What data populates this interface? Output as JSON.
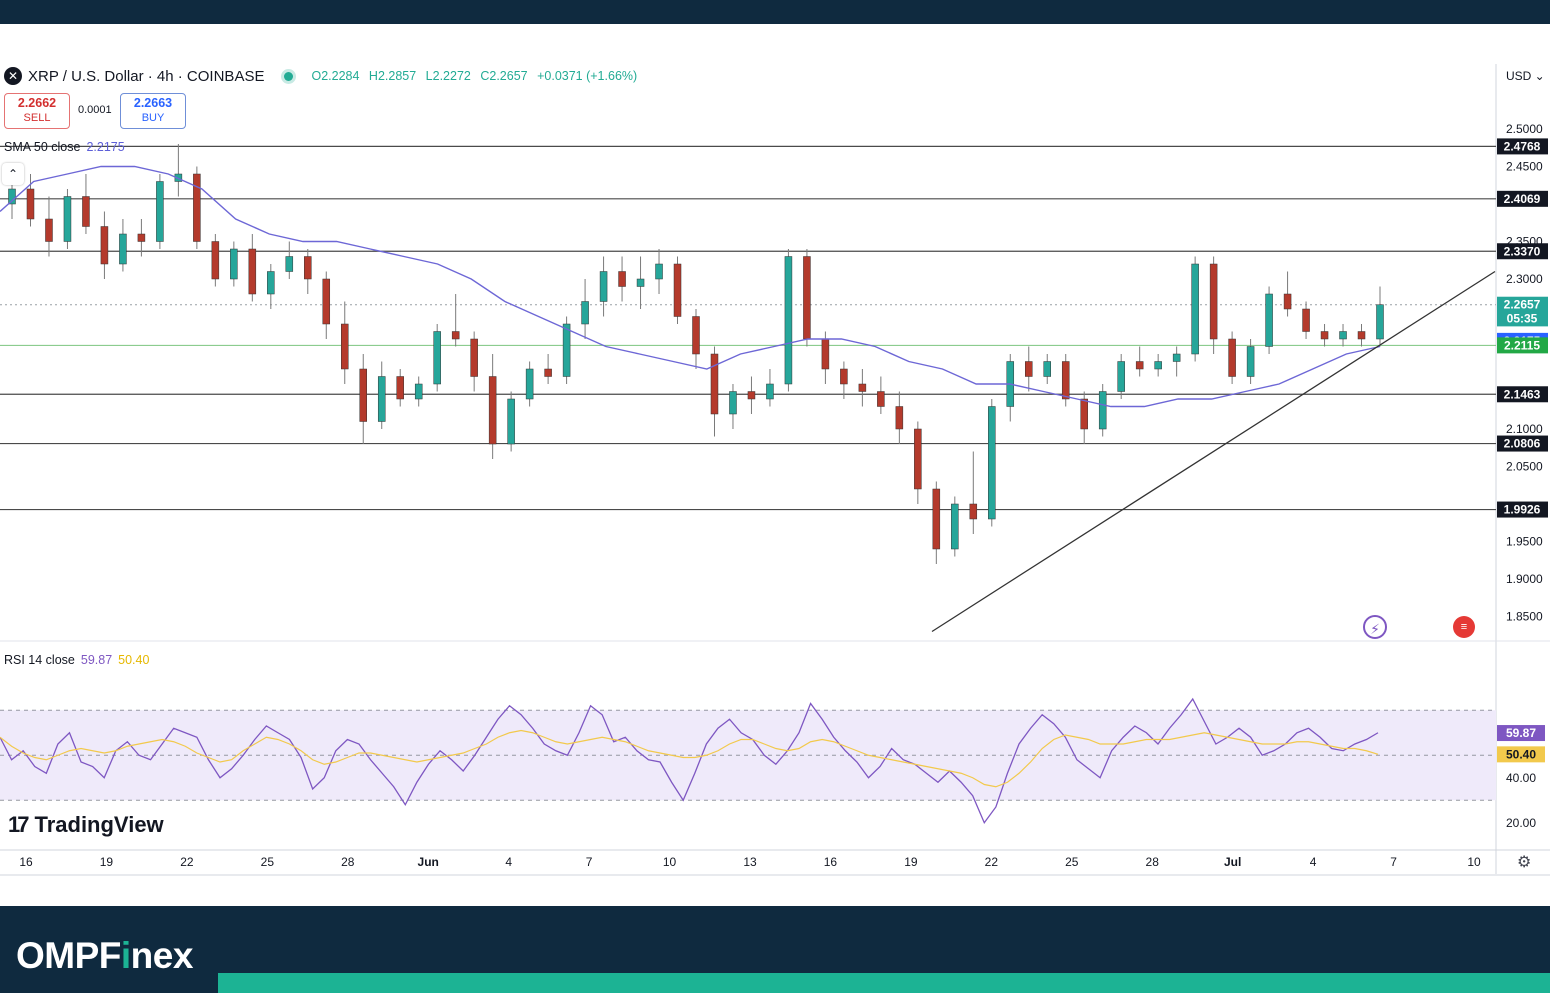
{
  "header": {
    "symbol_icon": "x-icon",
    "title": "XRP / U.S. Dollar · 4h · COINBASE",
    "open": "O2.2284",
    "high": "H2.2857",
    "low": "L2.2272",
    "close": "C2.2657",
    "change": "+0.0371 (+1.66%)",
    "status_color": "#22ab94"
  },
  "trade": {
    "sell_price": "2.2662",
    "sell_label": "SELL",
    "spread": "0.0001",
    "buy_price": "2.2663",
    "buy_label": "BUY"
  },
  "sma": {
    "label": "SMA 50 close",
    "value": "2.2175",
    "color": "#5d5fd8"
  },
  "rsi": {
    "label": "RSI 14 close",
    "value": "59.87",
    "ma_value": "50.40",
    "color": "#7e57c2",
    "ma_color": "#f2c94c"
  },
  "currency": "USD",
  "tradingview_logo": "TradingView",
  "brand": {
    "prefix": "OMPF",
    "accent": "i",
    "suffix": "nex"
  },
  "icons": [
    "x-icon",
    "chevron-up-icon",
    "bolt-icon",
    "us-flag-icon",
    "settings-icon"
  ],
  "chart_data": [
    {
      "type": "candlestick",
      "title": "XRP / U.S. Dollar · 4h · COINBASE",
      "ylim": [
        1.82,
        2.56
      ],
      "y_ticks": [
        "2.5000",
        "2.4500",
        "2.3500",
        "2.3000",
        "2.1000",
        "2.0500",
        "1.9500",
        "1.9000",
        "1.8500"
      ],
      "x_ticks": [
        "16",
        "19",
        "22",
        "25",
        "28",
        "Jun",
        "4",
        "7",
        "10",
        "13",
        "16",
        "19",
        "22",
        "25",
        "28",
        "Jul",
        "4",
        "7",
        "10"
      ],
      "horizontal_levels": [
        2.4768,
        2.4069,
        2.337,
        2.1463,
        2.0806,
        1.9926
      ],
      "price_labels": [
        {
          "text": "2.4768",
          "value": 2.4768,
          "color": "#131722"
        },
        {
          "text": "2.4069",
          "value": 2.4069,
          "color": "#131722"
        },
        {
          "text": "2.3370",
          "value": 2.337,
          "color": "#131722"
        },
        {
          "text": "2.2657",
          "value": 2.2657,
          "color": "#26a69a"
        },
        {
          "text": "05:35",
          "value": 2.2475,
          "color": "#26a69a"
        },
        {
          "text": "2.2175",
          "value": 2.2175,
          "color": "#2962ff"
        },
        {
          "text": "2.2115",
          "value": 2.2115,
          "color": "#22a846"
        },
        {
          "text": "2.1463",
          "value": 2.1463,
          "color": "#131722"
        },
        {
          "text": "2.0806",
          "value": 2.0806,
          "color": "#131722"
        },
        {
          "text": "1.9926",
          "value": 1.9926,
          "color": "#131722"
        }
      ],
      "current_price": 2.2657,
      "trendline": [
        {
          "x": 0.6,
          "y": 1.83
        },
        {
          "x": 1.0,
          "y": 2.31
        }
      ],
      "sma50": [
        2.39,
        2.43,
        2.44,
        2.45,
        2.45,
        2.44,
        2.42,
        2.38,
        2.36,
        2.35,
        2.35,
        2.34,
        2.33,
        2.32,
        2.3,
        2.27,
        2.25,
        2.23,
        2.21,
        2.2,
        2.19,
        2.18,
        2.2,
        2.21,
        2.22,
        2.22,
        2.21,
        2.19,
        2.18,
        2.16,
        2.16,
        2.15,
        2.14,
        2.13,
        2.13,
        2.14,
        2.14,
        2.15,
        2.16,
        2.18,
        2.2,
        2.21
      ],
      "candles_ohlc": [
        [
          2.4,
          2.44,
          2.38,
          2.42
        ],
        [
          2.42,
          2.44,
          2.37,
          2.38
        ],
        [
          2.38,
          2.41,
          2.33,
          2.35
        ],
        [
          2.35,
          2.42,
          2.34,
          2.41
        ],
        [
          2.41,
          2.44,
          2.36,
          2.37
        ],
        [
          2.37,
          2.39,
          2.3,
          2.32
        ],
        [
          2.32,
          2.38,
          2.31,
          2.36
        ],
        [
          2.36,
          2.38,
          2.33,
          2.35
        ],
        [
          2.35,
          2.44,
          2.34,
          2.43
        ],
        [
          2.43,
          2.48,
          2.41,
          2.44
        ],
        [
          2.44,
          2.45,
          2.34,
          2.35
        ],
        [
          2.35,
          2.36,
          2.29,
          2.3
        ],
        [
          2.3,
          2.35,
          2.29,
          2.34
        ],
        [
          2.34,
          2.36,
          2.27,
          2.28
        ],
        [
          2.28,
          2.32,
          2.26,
          2.31
        ],
        [
          2.31,
          2.35,
          2.3,
          2.33
        ],
        [
          2.33,
          2.34,
          2.28,
          2.3
        ],
        [
          2.3,
          2.31,
          2.22,
          2.24
        ],
        [
          2.24,
          2.27,
          2.16,
          2.18
        ],
        [
          2.18,
          2.2,
          2.08,
          2.11
        ],
        [
          2.11,
          2.19,
          2.1,
          2.17
        ],
        [
          2.17,
          2.18,
          2.13,
          2.14
        ],
        [
          2.14,
          2.17,
          2.13,
          2.16
        ],
        [
          2.16,
          2.24,
          2.15,
          2.23
        ],
        [
          2.23,
          2.28,
          2.21,
          2.22
        ],
        [
          2.22,
          2.23,
          2.15,
          2.17
        ],
        [
          2.17,
          2.2,
          2.06,
          2.08
        ],
        [
          2.08,
          2.15,
          2.07,
          2.14
        ],
        [
          2.14,
          2.19,
          2.13,
          2.18
        ],
        [
          2.18,
          2.2,
          2.16,
          2.17
        ],
        [
          2.17,
          2.25,
          2.16,
          2.24
        ],
        [
          2.24,
          2.3,
          2.22,
          2.27
        ],
        [
          2.27,
          2.33,
          2.25,
          2.31
        ],
        [
          2.31,
          2.33,
          2.27,
          2.29
        ],
        [
          2.29,
          2.33,
          2.26,
          2.3
        ],
        [
          2.3,
          2.34,
          2.28,
          2.32
        ],
        [
          2.32,
          2.33,
          2.24,
          2.25
        ],
        [
          2.25,
          2.26,
          2.18,
          2.2
        ],
        [
          2.2,
          2.21,
          2.09,
          2.12
        ],
        [
          2.12,
          2.16,
          2.1,
          2.15
        ],
        [
          2.15,
          2.17,
          2.12,
          2.14
        ],
        [
          2.14,
          2.18,
          2.13,
          2.16
        ],
        [
          2.16,
          2.34,
          2.15,
          2.33
        ],
        [
          2.33,
          2.34,
          2.21,
          2.22
        ],
        [
          2.22,
          2.23,
          2.16,
          2.18
        ],
        [
          2.18,
          2.19,
          2.14,
          2.16
        ],
        [
          2.16,
          2.18,
          2.13,
          2.15
        ],
        [
          2.15,
          2.17,
          2.12,
          2.13
        ],
        [
          2.13,
          2.15,
          2.08,
          2.1
        ],
        [
          2.1,
          2.11,
          2.0,
          2.02
        ],
        [
          2.02,
          2.03,
          1.92,
          1.94
        ],
        [
          1.94,
          2.01,
          1.93,
          2.0
        ],
        [
          2.0,
          2.07,
          1.96,
          1.98
        ],
        [
          1.98,
          2.14,
          1.97,
          2.13
        ],
        [
          2.13,
          2.2,
          2.11,
          2.19
        ],
        [
          2.19,
          2.21,
          2.15,
          2.17
        ],
        [
          2.17,
          2.2,
          2.16,
          2.19
        ],
        [
          2.19,
          2.2,
          2.13,
          2.14
        ],
        [
          2.14,
          2.15,
          2.08,
          2.1
        ],
        [
          2.1,
          2.16,
          2.09,
          2.15
        ],
        [
          2.15,
          2.2,
          2.14,
          2.19
        ],
        [
          2.19,
          2.21,
          2.17,
          2.18
        ],
        [
          2.18,
          2.2,
          2.17,
          2.19
        ],
        [
          2.19,
          2.21,
          2.17,
          2.2
        ],
        [
          2.2,
          2.33,
          2.19,
          2.32
        ],
        [
          2.32,
          2.33,
          2.2,
          2.22
        ],
        [
          2.22,
          2.23,
          2.16,
          2.17
        ],
        [
          2.17,
          2.22,
          2.16,
          2.21
        ],
        [
          2.21,
          2.29,
          2.2,
          2.28
        ],
        [
          2.28,
          2.31,
          2.25,
          2.26
        ],
        [
          2.26,
          2.27,
          2.22,
          2.23
        ],
        [
          2.23,
          2.24,
          2.21,
          2.22
        ],
        [
          2.22,
          2.24,
          2.21,
          2.23
        ],
        [
          2.23,
          2.24,
          2.21,
          2.22
        ],
        [
          2.22,
          2.29,
          2.21,
          2.2657
        ]
      ]
    },
    {
      "type": "line",
      "title": "RSI 14 close",
      "ylim": [
        15,
        95
      ],
      "y_ticks": [
        "40.00",
        "20.00"
      ],
      "band": [
        30,
        70
      ],
      "midline": 50,
      "price_labels": [
        {
          "text": "59.87",
          "value": 59.87,
          "color": "#7e57c2"
        },
        {
          "text": "50.40",
          "value": 50.4,
          "color": "#f2c94c"
        }
      ],
      "series": [
        {
          "color": "#7e57c2",
          "values": [
            58,
            48,
            52,
            45,
            42,
            55,
            60,
            47,
            45,
            40,
            52,
            56,
            50,
            48,
            55,
            62,
            60,
            58,
            48,
            40,
            44,
            50,
            57,
            63,
            60,
            57,
            49,
            35,
            40,
            52,
            57,
            55,
            48,
            42,
            36,
            28,
            38,
            46,
            52,
            48,
            43,
            50,
            58,
            66,
            72,
            68,
            62,
            55,
            52,
            50,
            60,
            72,
            68,
            56,
            58,
            52,
            48,
            47,
            38,
            30,
            42,
            55,
            62,
            66,
            60,
            57,
            50,
            46,
            52,
            60,
            73,
            66,
            58,
            52,
            47,
            40,
            45,
            53,
            48,
            46,
            42,
            38,
            43,
            38,
            32,
            20,
            27,
            42,
            55,
            62,
            68,
            64,
            58,
            48,
            44,
            40,
            52,
            58,
            63,
            60,
            55,
            62,
            68,
            75,
            65,
            55,
            58,
            62,
            58,
            50,
            52,
            55,
            60,
            62,
            58,
            53,
            52,
            55,
            57,
            60
          ]
        },
        {
          "color": "#f2c94c",
          "values": [
            58,
            54,
            51,
            49,
            48,
            50,
            52,
            53,
            52,
            51,
            52,
            54,
            55,
            56,
            57,
            56,
            54,
            51,
            49,
            47,
            48,
            52,
            55,
            58,
            57,
            55,
            52,
            48,
            46,
            47,
            49,
            51,
            51,
            50,
            49,
            48,
            47,
            48,
            49,
            50,
            51,
            53,
            55,
            58,
            60,
            61,
            60,
            58,
            56,
            55,
            56,
            57,
            58,
            57,
            56,
            54,
            52,
            51,
            50,
            49,
            49,
            50,
            52,
            55,
            57,
            57,
            55,
            53,
            52,
            53,
            56,
            57,
            56,
            54,
            52,
            50,
            49,
            48,
            47,
            46,
            45,
            44,
            43,
            42,
            40,
            37,
            36,
            38,
            42,
            47,
            53,
            57,
            59,
            58,
            57,
            55,
            55,
            55,
            56,
            57,
            57,
            57,
            58,
            59,
            60,
            59,
            58,
            57,
            56,
            55,
            55,
            55,
            56,
            56,
            55,
            54,
            53,
            53,
            52,
            50.4
          ]
        }
      ]
    }
  ]
}
